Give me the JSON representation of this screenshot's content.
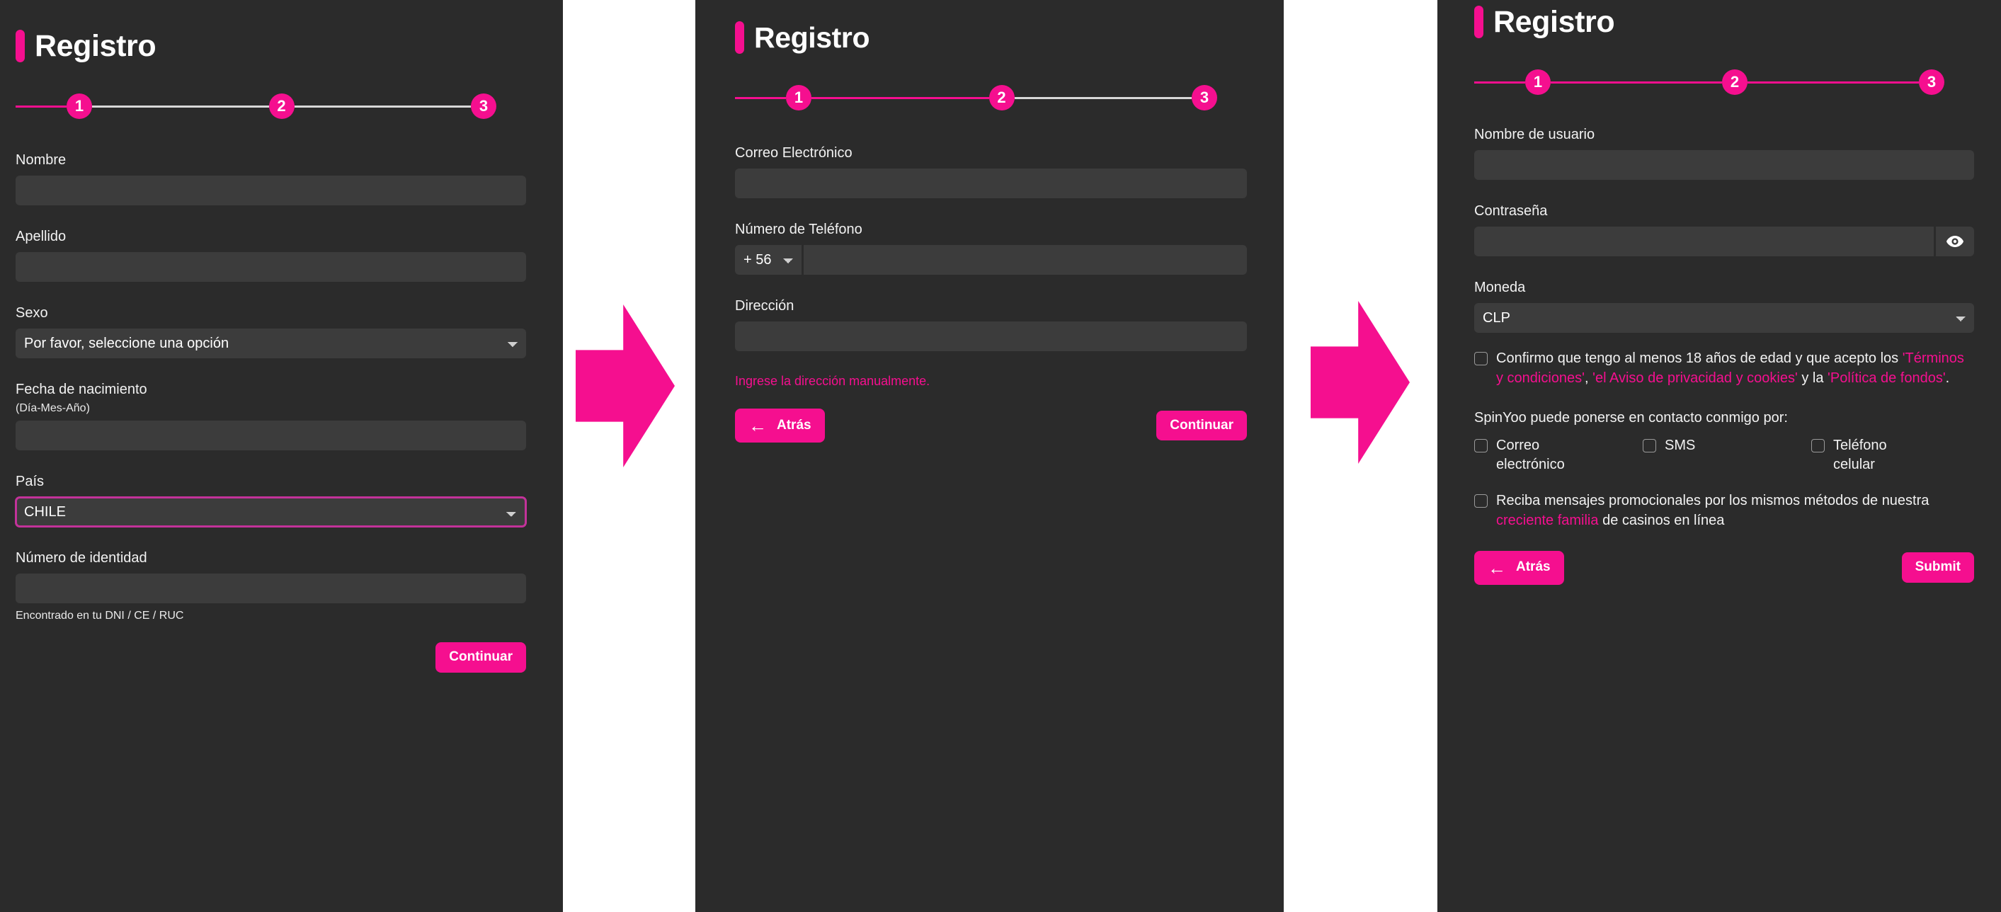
{
  "theme": {
    "accent": "#f50f8f",
    "panel_bg": "#2b2b2b",
    "input_bg": "#3c3c3c",
    "page_bg": "#ffffff",
    "text": "#ffffff",
    "step_inactive_line": "#d8d8d8"
  },
  "step1": {
    "title": "Registro",
    "stepper": {
      "steps": [
        "1",
        "2",
        "3"
      ],
      "active_index": 1,
      "completed_segments": 0
    },
    "fields": {
      "nombre": {
        "label": "Nombre",
        "value": "",
        "placeholder": ""
      },
      "apellido": {
        "label": "Apellido",
        "value": "",
        "placeholder": ""
      },
      "sexo": {
        "label": "Sexo",
        "selected": "Por favor, seleccione una opción",
        "options": [
          "Por favor, seleccione una opción"
        ]
      },
      "fecha": {
        "label": "Fecha de nacimiento",
        "sublabel": "(Día-Mes-Año)",
        "value": "",
        "placeholder": ""
      },
      "pais": {
        "label": "País",
        "selected": "CHILE",
        "options": [
          "CHILE"
        ],
        "focused": true
      },
      "identidad": {
        "label": "Número de identidad",
        "value": "",
        "placeholder": "",
        "hint": "Encontrado en tu DNI / CE / RUC"
      }
    },
    "buttons": {
      "continue": "Continuar"
    }
  },
  "step2": {
    "title": "Registro",
    "stepper": {
      "steps": [
        "1",
        "2",
        "3"
      ],
      "active_index": 2,
      "completed_segments": 1
    },
    "fields": {
      "correo": {
        "label": "Correo Electrónico",
        "value": "",
        "placeholder": ""
      },
      "telefono": {
        "label": "Número de Teléfono",
        "code_selected": "+ 56",
        "code_options": [
          "+ 56"
        ],
        "value": "",
        "placeholder": ""
      },
      "direccion": {
        "label": "Dirección",
        "value": "",
        "placeholder": ""
      }
    },
    "error": "Ingrese la dirección manualmente.",
    "buttons": {
      "back": "Atrás",
      "continue": "Continuar",
      "back_icon": "arrow-left-icon"
    }
  },
  "step3": {
    "title": "Registro",
    "stepper": {
      "steps": [
        "1",
        "2",
        "3"
      ],
      "active_index": 3,
      "completed_segments": 2
    },
    "fields": {
      "usuario": {
        "label": "Nombre de usuario",
        "value": "",
        "placeholder": ""
      },
      "contrasena": {
        "label": "Contraseña",
        "value": "",
        "placeholder": "",
        "toggle_icon": "eye-icon"
      },
      "moneda": {
        "label": "Moneda",
        "selected": "CLP",
        "options": [
          "CLP"
        ]
      }
    },
    "terms": {
      "checked": false,
      "part1": "Confirmo que tengo al menos 18 años de edad y que acepto los ",
      "link1": "'Términos y condiciones'",
      "sep1": ", ",
      "link2": "'el Aviso de privacidad y cookies'",
      "sep2": " y la ",
      "link3": "'Política de fondos'",
      "end": "."
    },
    "contact": {
      "title": "SpinYoo puede ponerse en contacto conmigo por:",
      "options": [
        {
          "label": "Correo electrónico",
          "checked": false
        },
        {
          "label": "SMS",
          "checked": false
        },
        {
          "label": "Teléfono celular",
          "checked": false
        }
      ]
    },
    "promo": {
      "checked": false,
      "part1": "Reciba mensajes promocionales por los mismos métodos de nuestra ",
      "link": "creciente familia",
      "part2": " de casinos en línea"
    },
    "buttons": {
      "back": "Atrás",
      "submit": "Submit",
      "back_icon": "arrow-left-icon"
    }
  }
}
